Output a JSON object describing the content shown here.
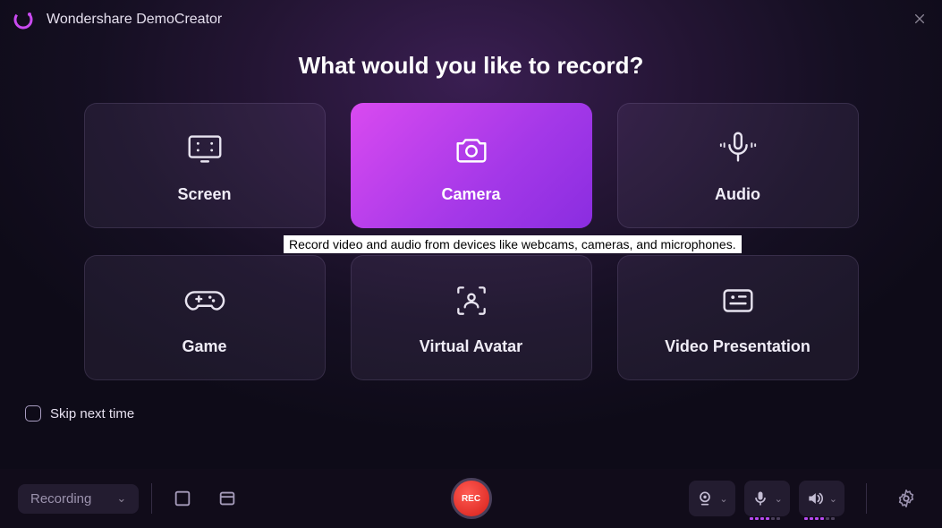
{
  "app": {
    "title": "Wondershare DemoCreator"
  },
  "heading": "What would you like to record?",
  "cards": [
    {
      "label": "Screen"
    },
    {
      "label": "Camera"
    },
    {
      "label": "Audio"
    },
    {
      "label": "Game"
    },
    {
      "label": "Virtual Avatar"
    },
    {
      "label": "Video Presentation"
    }
  ],
  "tooltip": "Record video and audio from devices like webcams, cameras, and microphones.",
  "skip": {
    "label": "Skip next time",
    "checked": false
  },
  "bottombar": {
    "mode": "Recording",
    "rec": "REC"
  }
}
